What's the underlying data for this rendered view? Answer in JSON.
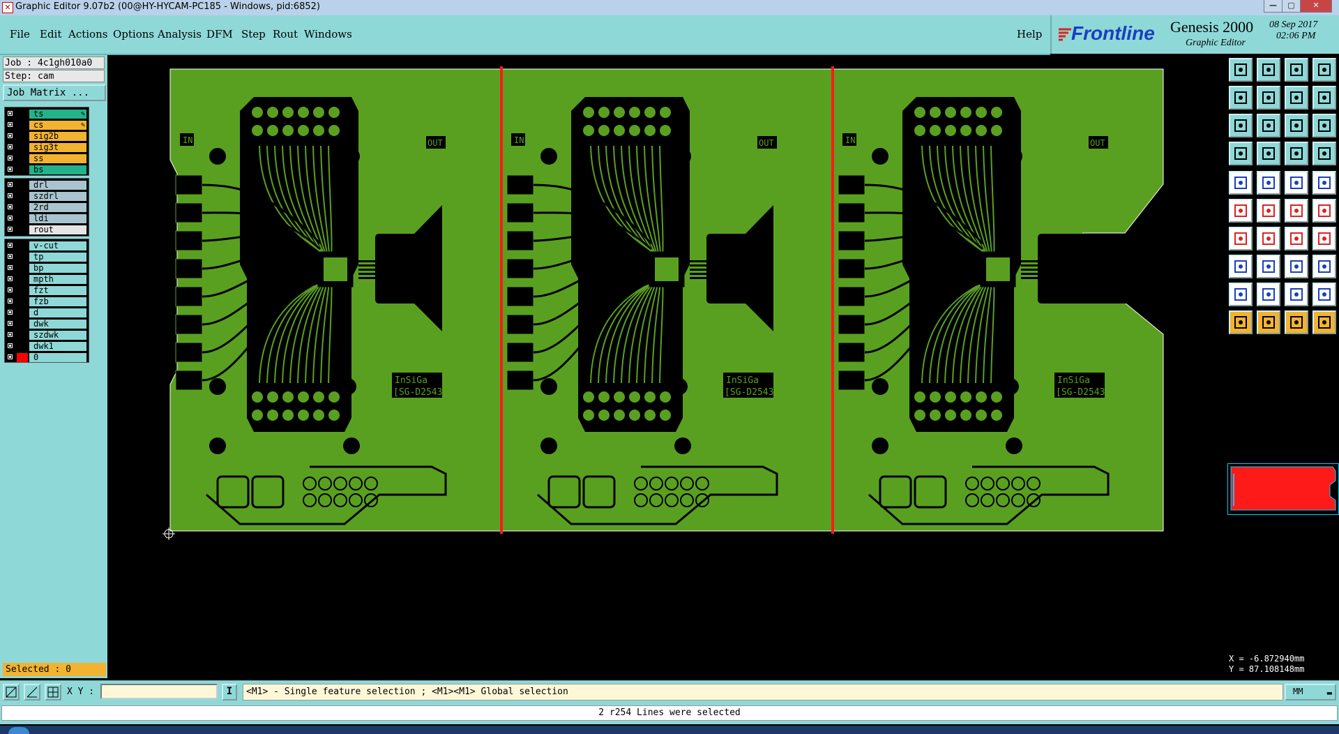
{
  "window": {
    "title": "Graphic Editor 9.07b2 (00@HY-HYCAM-PC185 - Windows, pid:6852)",
    "icon": "app-x-icon"
  },
  "menu": {
    "items": [
      "File",
      "Edit",
      "Actions",
      "Options",
      "Analysis",
      "DFM",
      "Step",
      "Rout",
      "Windows"
    ],
    "help": "Help"
  },
  "brand": {
    "logo": "Frontline",
    "product": "Genesis 2000",
    "subtitle": "Graphic Editor",
    "date": "08 Sep 2017",
    "time": "02:06 PM"
  },
  "job": {
    "job_label": "Job : 4c1gh010a0",
    "step_label": "Step: cam",
    "matrix_button": "Job Matrix ..."
  },
  "layers": {
    "group1": [
      {
        "name": "ts",
        "color": "#22b38a",
        "marker": "✎"
      },
      {
        "name": "cs",
        "color": "#f2b330",
        "marker": "✎",
        "active": true
      },
      {
        "name": "sig2b",
        "color": "#f2b330"
      },
      {
        "name": "sig3t",
        "color": "#f2b330"
      },
      {
        "name": "ss",
        "color": "#f2b330"
      },
      {
        "name": "bs",
        "color": "#22b38a"
      }
    ],
    "group2": [
      {
        "name": "drl",
        "color": "#a9c4cf"
      },
      {
        "name": "szdrl",
        "color": "#a9c4cf"
      },
      {
        "name": "2rd",
        "color": "#a9c4cf"
      },
      {
        "name": "ldi",
        "color": "#a9c4cf"
      },
      {
        "name": "rout",
        "color": "#e5e5e5"
      }
    ],
    "group3": [
      {
        "name": "v-cut",
        "color": "#8fd8d8"
      },
      {
        "name": "tp",
        "color": "#8fd8d8"
      },
      {
        "name": "bp",
        "color": "#8fd8d8"
      },
      {
        "name": "mpth",
        "color": "#8fd8d8"
      },
      {
        "name": "fzt",
        "color": "#8fd8d8"
      },
      {
        "name": "fzb",
        "color": "#8fd8d8"
      },
      {
        "name": "d",
        "color": "#8fd8d8"
      },
      {
        "name": "dwk",
        "color": "#8fd8d8"
      },
      {
        "name": "szdwk",
        "color": "#8fd8d8"
      },
      {
        "name": "dwk1",
        "color": "#8fd8d8"
      },
      {
        "name": "0",
        "color": "#8fd8d8",
        "swatch": "#ff0000"
      }
    ]
  },
  "selected_label": "Selected : 0",
  "board": {
    "panels": 3,
    "in_label": "IN",
    "out_label": "OUT",
    "part_line1": "InSiGa",
    "part_line2": "[SG-D2543",
    "board_color": "#5aa020",
    "cut_line_color": "#ff1a1a"
  },
  "coords": {
    "x": "X = -6.872940mm",
    "y": "Y = 87.108148mm"
  },
  "command_bar": {
    "xy_label": "X Y :",
    "xy_value": "",
    "hint": "<M1> - Single feature selection ; <M1><M1> Global selection",
    "units": "MM"
  },
  "status": "2 r254 Lines were selected"
}
